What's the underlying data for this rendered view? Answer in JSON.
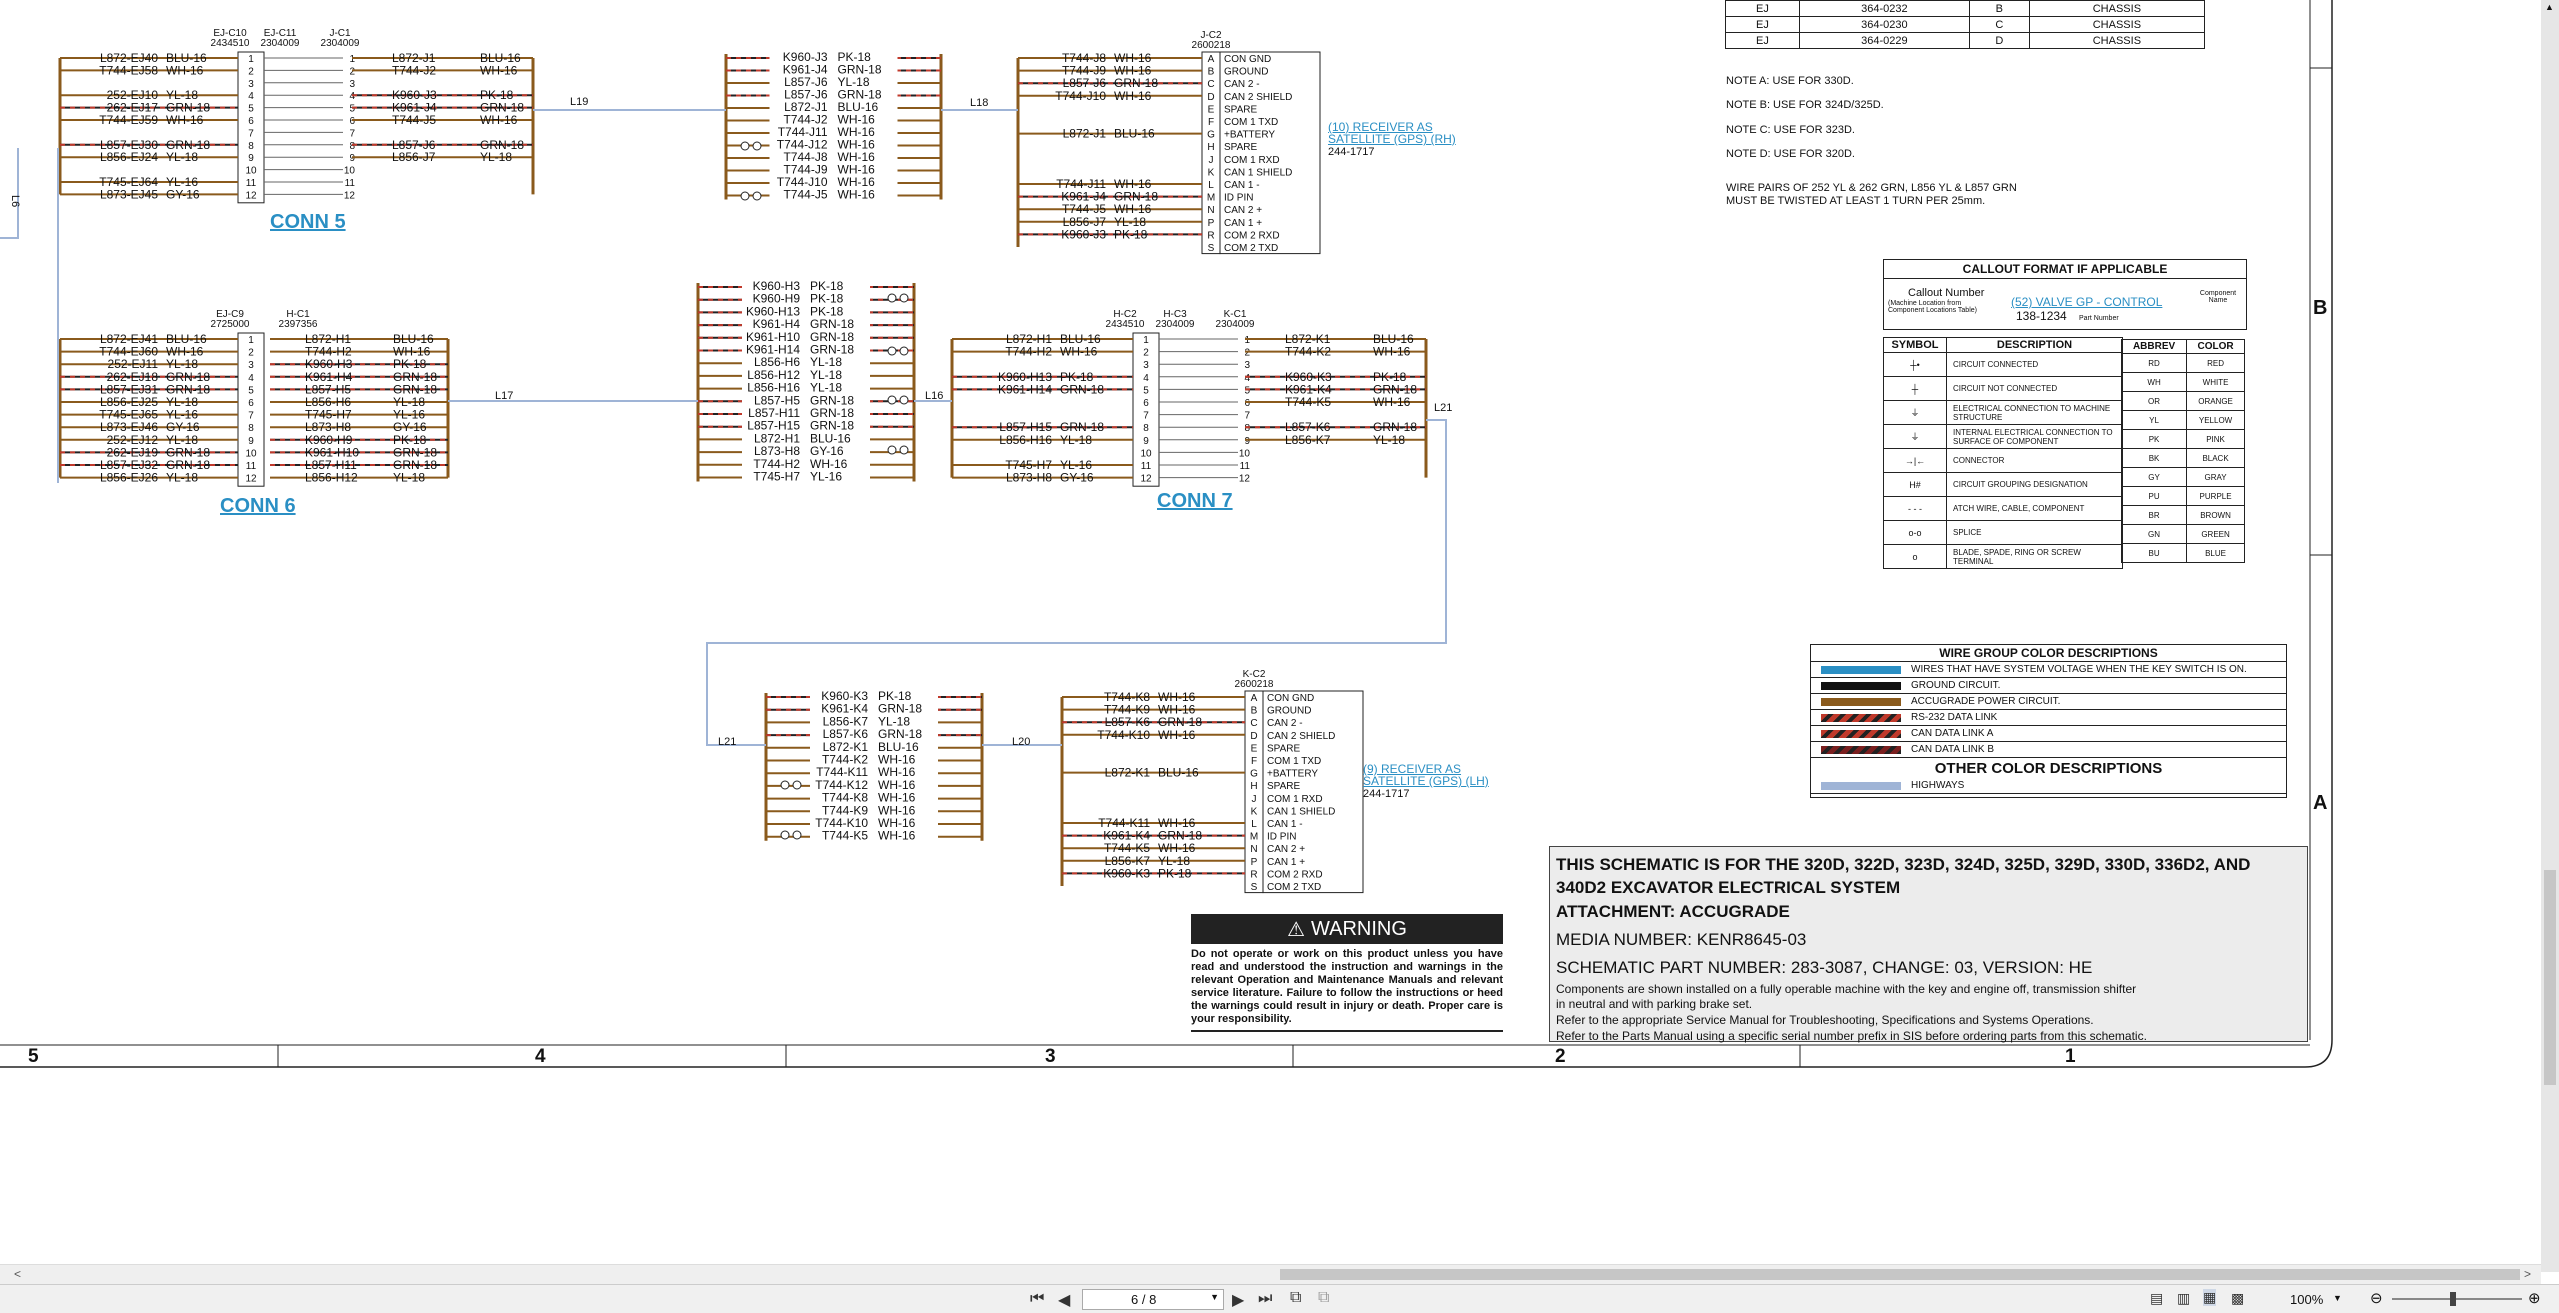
{
  "title_block": {
    "line1": "THIS SCHEMATIC IS FOR THE 320D, 322D, 323D, 324D, 325D, 329D, 330D, 336D2, AND",
    "line2": "340D2 EXCAVATOR ELECTRICAL SYSTEM",
    "line3": "ATTACHMENT: ACCUGRADE",
    "media": "MEDIA NUMBER: KENR8645-03",
    "part": "SCHEMATIC PART NUMBER: 283-3087, CHANGE: 03, VERSION: HE",
    "note1": "Components are shown installed on a fully operable machine with the key and engine off, transmission shifter",
    "note2": "in neutral and with parking brake set.",
    "note3": "Refer to the appropriate Service Manual for Troubleshooting, Specifications and Systems Operations.",
    "note4": "Refer to the Parts Manual using a specific serial number prefix in SIS before ordering parts from this schematic."
  },
  "warning": {
    "title": "WARNING",
    "text": "Do not operate or work on this product unless you have read and understood the instruction and warnings in the relevant Operation and Maintenance Manuals and relevant service literature. Failure to follow the instructions or heed the warnings could result in injury or death. Proper care is your responsibility."
  },
  "ref_table": [
    [
      "EJ",
      "364-0232",
      "B",
      "CHASSIS"
    ],
    [
      "EJ",
      "364-0230",
      "C",
      "CHASSIS"
    ],
    [
      "EJ",
      "364-0229",
      "D",
      "CHASSIS"
    ]
  ],
  "notes": {
    "a": "NOTE A: USE FOR 330D.",
    "b": "NOTE B: USE FOR 324D/325D.",
    "c": "NOTE C: USE FOR 323D.",
    "d": "NOTE D: USE FOR 320D.",
    "twist1": "WIRE PAIRS OF 252 YL & 262 GRN, L856 YL & L857 GRN",
    "twist2": "MUST BE TWISTED AT LEAST 1 TURN PER 25mm."
  },
  "callout": {
    "header": "CALLOUT FORMAT IF APPLICABLE",
    "callout_number": "Callout Number",
    "machine_loc": "(Machine Location from Component Locations Table)",
    "sample": "(52) VALVE GP - CONTROL",
    "part_no": "138-1234",
    "part_number_label": "Part Number",
    "component_name": "Component Name"
  },
  "symbols": {
    "header_symbol": "SYMBOL",
    "header_desc": "DESCRIPTION",
    "items": [
      {
        "glyph": "┼•",
        "desc": "CIRCUIT CONNECTED"
      },
      {
        "glyph": "┼",
        "desc": "CIRCUIT NOT CONNECTED"
      },
      {
        "glyph": "⏚",
        "desc": "ELECTRICAL CONNECTION TO MACHINE STRUCTURE"
      },
      {
        "glyph": "⏚",
        "desc": "INTERNAL ELECTRICAL CONNECTION TO SURFACE OF COMPONENT"
      },
      {
        "glyph": "→|←",
        "desc": "CONNECTOR"
      },
      {
        "glyph": "H#",
        "desc": "CIRCUIT GROUPING DESIGNATION"
      },
      {
        "glyph": "- - -",
        "desc": "ATCH WIRE, CABLE, COMPONENT"
      },
      {
        "glyph": "o-o",
        "desc": "SPLICE"
      },
      {
        "glyph": "o",
        "desc": "BLADE, SPADE, RING OR SCREW TERMINAL"
      }
    ]
  },
  "abbrev": {
    "header_abbrev": "ABBREV",
    "header_color": "COLOR",
    "items": [
      [
        "RD",
        "RED"
      ],
      [
        "WH",
        "WHITE"
      ],
      [
        "OR",
        "ORANGE"
      ],
      [
        "YL",
        "YELLOW"
      ],
      [
        "PK",
        "PINK"
      ],
      [
        "BK",
        "BLACK"
      ],
      [
        "GY",
        "GRAY"
      ],
      [
        "PU",
        "PURPLE"
      ],
      [
        "BR",
        "BROWN"
      ],
      [
        "GN",
        "GREEN"
      ],
      [
        "BU",
        "BLUE"
      ]
    ]
  },
  "wire_groups": {
    "header": "WIRE GROUP COLOR DESCRIPTIONS",
    "items": [
      {
        "color": "#2a8fc4",
        "desc": "WIRES THAT HAVE SYSTEM VOLTAGE WHEN THE KEY SWITCH IS ON."
      },
      {
        "color": "#111111",
        "desc": "GROUND CIRCUIT."
      },
      {
        "color": "#8a5a1c",
        "desc": "ACCUGRADE POWER CIRCUIT."
      },
      {
        "color": "#c0392b",
        "desc": "RS-232 DATA LINK"
      },
      {
        "color": "#c0392b",
        "desc": "CAN DATA LINK A"
      },
      {
        "color": "#7a1f1f",
        "desc": "CAN DATA LINK B"
      }
    ],
    "other_header": "OTHER COLOR DESCRIPTIONS",
    "other_items": [
      {
        "color": "#9fb4d6",
        "desc": "HIGHWAYS"
      }
    ]
  },
  "zones": [
    "5",
    "4",
    "3",
    "2",
    "1"
  ],
  "side_zones": [
    "B",
    "A"
  ],
  "conn5": {
    "label": "CONN 5",
    "hdr_left": "EJ-C10",
    "hdr_left_pn": "2434510",
    "hdr_mid": "EJ-C11",
    "hdr_mid_pn": "2304009",
    "hdr_right": "J-C1",
    "hdr_right_pn": "2304009",
    "left": [
      [
        "L872-EJ40",
        "BLU-16"
      ],
      [
        "T744-EJ58",
        "WH-16"
      ],
      [
        "",
        ""
      ],
      [
        "252-EJ10",
        "YL-18"
      ],
      [
        "262-EJ17",
        "GRN-18"
      ],
      [
        "T744-EJ59",
        "WH-16"
      ],
      [
        "",
        ""
      ],
      [
        "L857-EJ30",
        "GRN-18"
      ],
      [
        "L856-EJ24",
        "YL-18"
      ],
      [
        "",
        ""
      ],
      [
        "T745-EJ64",
        "YL-16"
      ],
      [
        "L873-EJ45",
        "GY-16"
      ]
    ],
    "right": [
      [
        "L872-J1",
        "BLU-16"
      ],
      [
        "T744-J2",
        "WH-16"
      ],
      [
        "",
        ""
      ],
      [
        "K960-J3",
        "PK-18"
      ],
      [
        "K961-J4",
        "GRN-18"
      ],
      [
        "T744-J5",
        "WH-16"
      ],
      [
        "",
        ""
      ],
      [
        "L857-J6",
        "GRN-18"
      ],
      [
        "L856-J7",
        "YL-18"
      ],
      [
        "",
        ""
      ],
      [
        "",
        ""
      ],
      [
        "",
        ""
      ]
    ]
  },
  "conn6": {
    "label": "CONN 6",
    "hdr_left": "EJ-C9",
    "hdr_left_pn": "2725000",
    "hdr_right": "H-C1",
    "hdr_right_pn": "2397356",
    "left": [
      [
        "L872-EJ41",
        "BLU-16"
      ],
      [
        "T744-EJ60",
        "WH-16"
      ],
      [
        "252-EJ11",
        "YL-18"
      ],
      [
        "262-EJ18",
        "GRN-18"
      ],
      [
        "L857-EJ31",
        "GRN-18"
      ],
      [
        "L856-EJ25",
        "YL-18"
      ],
      [
        "T745-EJ65",
        "YL-16"
      ],
      [
        "L873-EJ46",
        "GY-16"
      ],
      [
        "252-EJ12",
        "YL-18"
      ],
      [
        "262-EJ19",
        "GRN-18"
      ],
      [
        "L857-EJ32",
        "GRN-18"
      ],
      [
        "L856-EJ26",
        "YL-18"
      ]
    ],
    "right": [
      [
        "L872-H1",
        "BLU-16"
      ],
      [
        "T744-H2",
        "WH-16"
      ],
      [
        "K960-H3",
        "PK-18"
      ],
      [
        "K961-H4",
        "GRN-18"
      ],
      [
        "L857-H5",
        "GRN-18"
      ],
      [
        "L856-H6",
        "YL-18"
      ],
      [
        "T745-H7",
        "YL-16"
      ],
      [
        "L873-H8",
        "GY-16"
      ],
      [
        "K960-H9",
        "PK-18"
      ],
      [
        "K961-H10",
        "GRN-18"
      ],
      [
        "L857-H11",
        "GRN-18"
      ],
      [
        "L856-H12",
        "YL-18"
      ]
    ]
  },
  "conn7": {
    "label": "CONN 7",
    "hdr_left": "H-C2",
    "hdr_left_pn": "2434510",
    "hdr_mid": "H-C3",
    "hdr_mid_pn": "2304009",
    "hdr_right": "K-C1",
    "hdr_right_pn": "2304009",
    "left": [
      [
        "L872-H1",
        "BLU-16"
      ],
      [
        "T744-H2",
        "WH-16"
      ],
      [
        "",
        ""
      ],
      [
        "K960-H13",
        "PK-18"
      ],
      [
        "K961-H14",
        "GRN-18"
      ],
      [
        "",
        ""
      ],
      [
        "",
        ""
      ],
      [
        "L857-H15",
        "GRN-18"
      ],
      [
        "L856-H16",
        "YL-18"
      ],
      [
        "",
        ""
      ],
      [
        "T745-H7",
        "YL-16"
      ],
      [
        "L873-H8",
        "GY-16"
      ]
    ],
    "right": [
      [
        "L872-K1",
        "BLU-16"
      ],
      [
        "T744-K2",
        "WH-16"
      ],
      [
        "",
        ""
      ],
      [
        "K960-K3",
        "PK-18"
      ],
      [
        "K961-K4",
        "GRN-18"
      ],
      [
        "T744-K5",
        "WH-16"
      ],
      [
        "",
        ""
      ],
      [
        "L857-K6",
        "GRN-18"
      ],
      [
        "L856-K7",
        "YL-18"
      ],
      [
        "",
        ""
      ],
      [
        "",
        ""
      ],
      [
        "",
        ""
      ]
    ]
  },
  "harness_j": [
    [
      "K960-J3",
      "PK-18"
    ],
    [
      "K961-J4",
      "GRN-18"
    ],
    [
      "L857-J6",
      "YL-18"
    ],
    [
      "L857-J6",
      "GRN-18"
    ],
    [
      "L872-J1",
      "BLU-16"
    ],
    [
      "T744-J2",
      "WH-16"
    ],
    [
      "T744-J11",
      "WH-16"
    ],
    [
      "T744-J12",
      "WH-16"
    ],
    [
      "T744-J8",
      "WH-16"
    ],
    [
      "T744-J9",
      "WH-16"
    ],
    [
      "T744-J10",
      "WH-16"
    ],
    [
      "T744-J5",
      "WH-16"
    ]
  ],
  "harness_h": [
    [
      "K960-H3",
      "PK-18"
    ],
    [
      "K960-H9",
      "PK-18"
    ],
    [
      "K960-H13",
      "PK-18"
    ],
    [
      "K961-H4",
      "GRN-18"
    ],
    [
      "K961-H10",
      "GRN-18"
    ],
    [
      "K961-H14",
      "GRN-18"
    ],
    [
      "L856-H6",
      "YL-18"
    ],
    [
      "L856-H12",
      "YL-18"
    ],
    [
      "L856-H16",
      "YL-18"
    ],
    [
      "L857-H5",
      "GRN-18"
    ],
    [
      "L857-H11",
      "GRN-18"
    ],
    [
      "L857-H15",
      "GRN-18"
    ],
    [
      "L872-H1",
      "BLU-16"
    ],
    [
      "L873-H8",
      "GY-16"
    ],
    [
      "T744-H2",
      "WH-16"
    ],
    [
      "T745-H7",
      "YL-16"
    ]
  ],
  "harness_k": [
    [
      "K960-K3",
      "PK-18"
    ],
    [
      "K961-K4",
      "GRN-18"
    ],
    [
      "L856-K7",
      "YL-18"
    ],
    [
      "L857-K6",
      "GRN-18"
    ],
    [
      "L872-K1",
      "BLU-16"
    ],
    [
      "T744-K2",
      "WH-16"
    ],
    [
      "T744-K11",
      "WH-16"
    ],
    [
      "T744-K12",
      "WH-16"
    ],
    [
      "T744-K8",
      "WH-16"
    ],
    [
      "T744-K9",
      "WH-16"
    ],
    [
      "T744-K10",
      "WH-16"
    ],
    [
      "T744-K5",
      "WH-16"
    ]
  ],
  "receiver_rh": {
    "conn": "J-C2",
    "pn": "2600218",
    "wires": [
      [
        "T744-J8",
        "WH-16"
      ],
      [
        "T744-J9",
        "WH-16"
      ],
      [
        "L857-J6",
        "GRN-18"
      ],
      [
        "T744-J10",
        "WH-16"
      ],
      [
        "",
        ""
      ],
      [
        "",
        ""
      ],
      [
        "L872-J1",
        "BLU-16"
      ],
      [
        "",
        ""
      ],
      [
        "",
        ""
      ],
      [
        "",
        ""
      ],
      [
        "T744-J11",
        "WH-16"
      ],
      [
        "K961-J4",
        "GRN-18"
      ],
      [
        "T744-J5",
        "WH-16"
      ],
      [
        "L856-J7",
        "YL-18"
      ],
      [
        "K960-J3",
        "PK-18"
      ]
    ],
    "pins": [
      "A",
      "B",
      "C",
      "D",
      "E",
      "F",
      "G",
      "H",
      "J",
      "K",
      "L",
      "M",
      "N",
      "P",
      "R",
      "S"
    ],
    "funcs": [
      "CON GND",
      "GROUND",
      "CAN 2 -",
      "CAN 2 SHIELD",
      "SPARE",
      "COM 1 TXD",
      "+BATTERY",
      "SPARE",
      "COM 1 RXD",
      "CAN 1 SHIELD",
      "CAN 1 -",
      "ID PIN",
      "CAN 2 +",
      "CAN 1 +",
      "COM 2 RXD",
      "COM 2 TXD"
    ],
    "name": "(10) RECEIVER AS",
    "name2": "SATELLITE (GPS) (RH)",
    "pn2": "244-1717"
  },
  "receiver_lh": {
    "conn": "K-C2",
    "pn": "2600218",
    "wires": [
      [
        "T744-K8",
        "WH-16"
      ],
      [
        "T744-K9",
        "WH-16"
      ],
      [
        "L857-K6",
        "GRN-18"
      ],
      [
        "T744-K10",
        "WH-16"
      ],
      [
        "",
        ""
      ],
      [
        "",
        ""
      ],
      [
        "L872-K1",
        "BLU-16"
      ],
      [
        "",
        ""
      ],
      [
        "",
        ""
      ],
      [
        "",
        ""
      ],
      [
        "T744-K11",
        "WH-16"
      ],
      [
        "K961-K4",
        "GRN-18"
      ],
      [
        "T744-K5",
        "WH-16"
      ],
      [
        "L856-K7",
        "YL-18"
      ],
      [
        "K960-K3",
        "PK-18"
      ]
    ],
    "pins": [
      "A",
      "B",
      "C",
      "D",
      "E",
      "F",
      "G",
      "H",
      "J",
      "K",
      "L",
      "M",
      "N",
      "P",
      "R",
      "S"
    ],
    "funcs": [
      "CON GND",
      "GROUND",
      "CAN 2 -",
      "CAN 2 SHIELD",
      "SPARE",
      "COM 1 TXD",
      "+BATTERY",
      "SPARE",
      "COM 1 RXD",
      "CAN 1 SHIELD",
      "CAN 1 -",
      "ID PIN",
      "CAN 2 +",
      "CAN 1 +",
      "COM 2 RXD",
      "COM 2 TXD"
    ],
    "name": "(9) RECEIVER AS",
    "name2": "SATELLITE (GPS) (LH)",
    "pn2": "244-1717"
  },
  "highway_labels": [
    "L6",
    "L19",
    "L18",
    "L17",
    "L16",
    "L21",
    "L21",
    "L20"
  ],
  "viewer": {
    "page": "6 / 8",
    "zoom": "100%"
  }
}
